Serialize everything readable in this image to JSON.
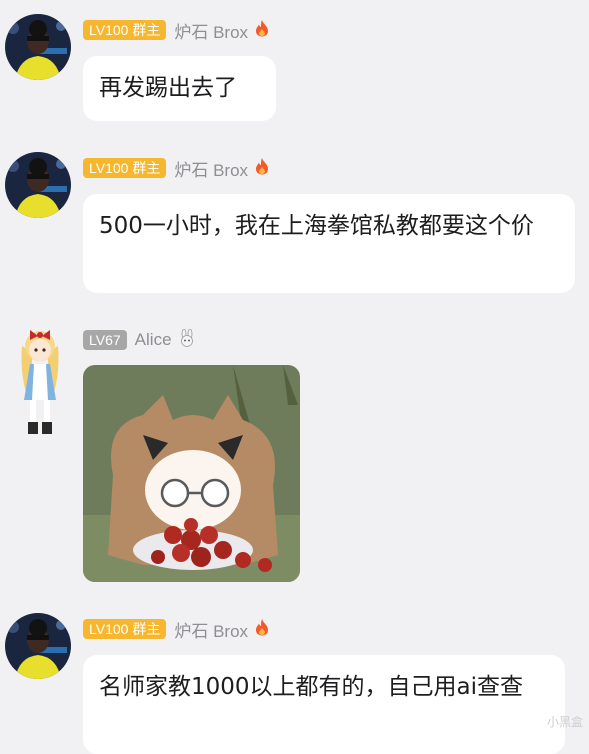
{
  "messages": [
    {
      "sender": "炉石 Brox",
      "badge": "LV100 群主",
      "icon": "flame-icon",
      "text": "再发踢出去了"
    },
    {
      "sender": "炉石 Brox",
      "badge": "LV100 群主",
      "icon": "flame-icon",
      "text": "500一小时，我在上海拳馆私教都要这个价"
    },
    {
      "sender": "Alice",
      "badge": "LV67",
      "icon": "bunny-icon",
      "sticker": "anime-girl-eating-berries-sticker"
    },
    {
      "sender": "炉石 Brox",
      "badge": "LV100 群主",
      "icon": "flame-icon",
      "text": "名师家教1000以上都有的，自己用ai查查"
    }
  ],
  "watermark": "小黑盒",
  "colors": {
    "background": "#f1f1f3",
    "bubble": "#ffffff",
    "owner_badge": "#f6b62d",
    "member_badge": "#a7a7a7",
    "name_text": "#8f8f93",
    "flame": "#f25a2a"
  }
}
